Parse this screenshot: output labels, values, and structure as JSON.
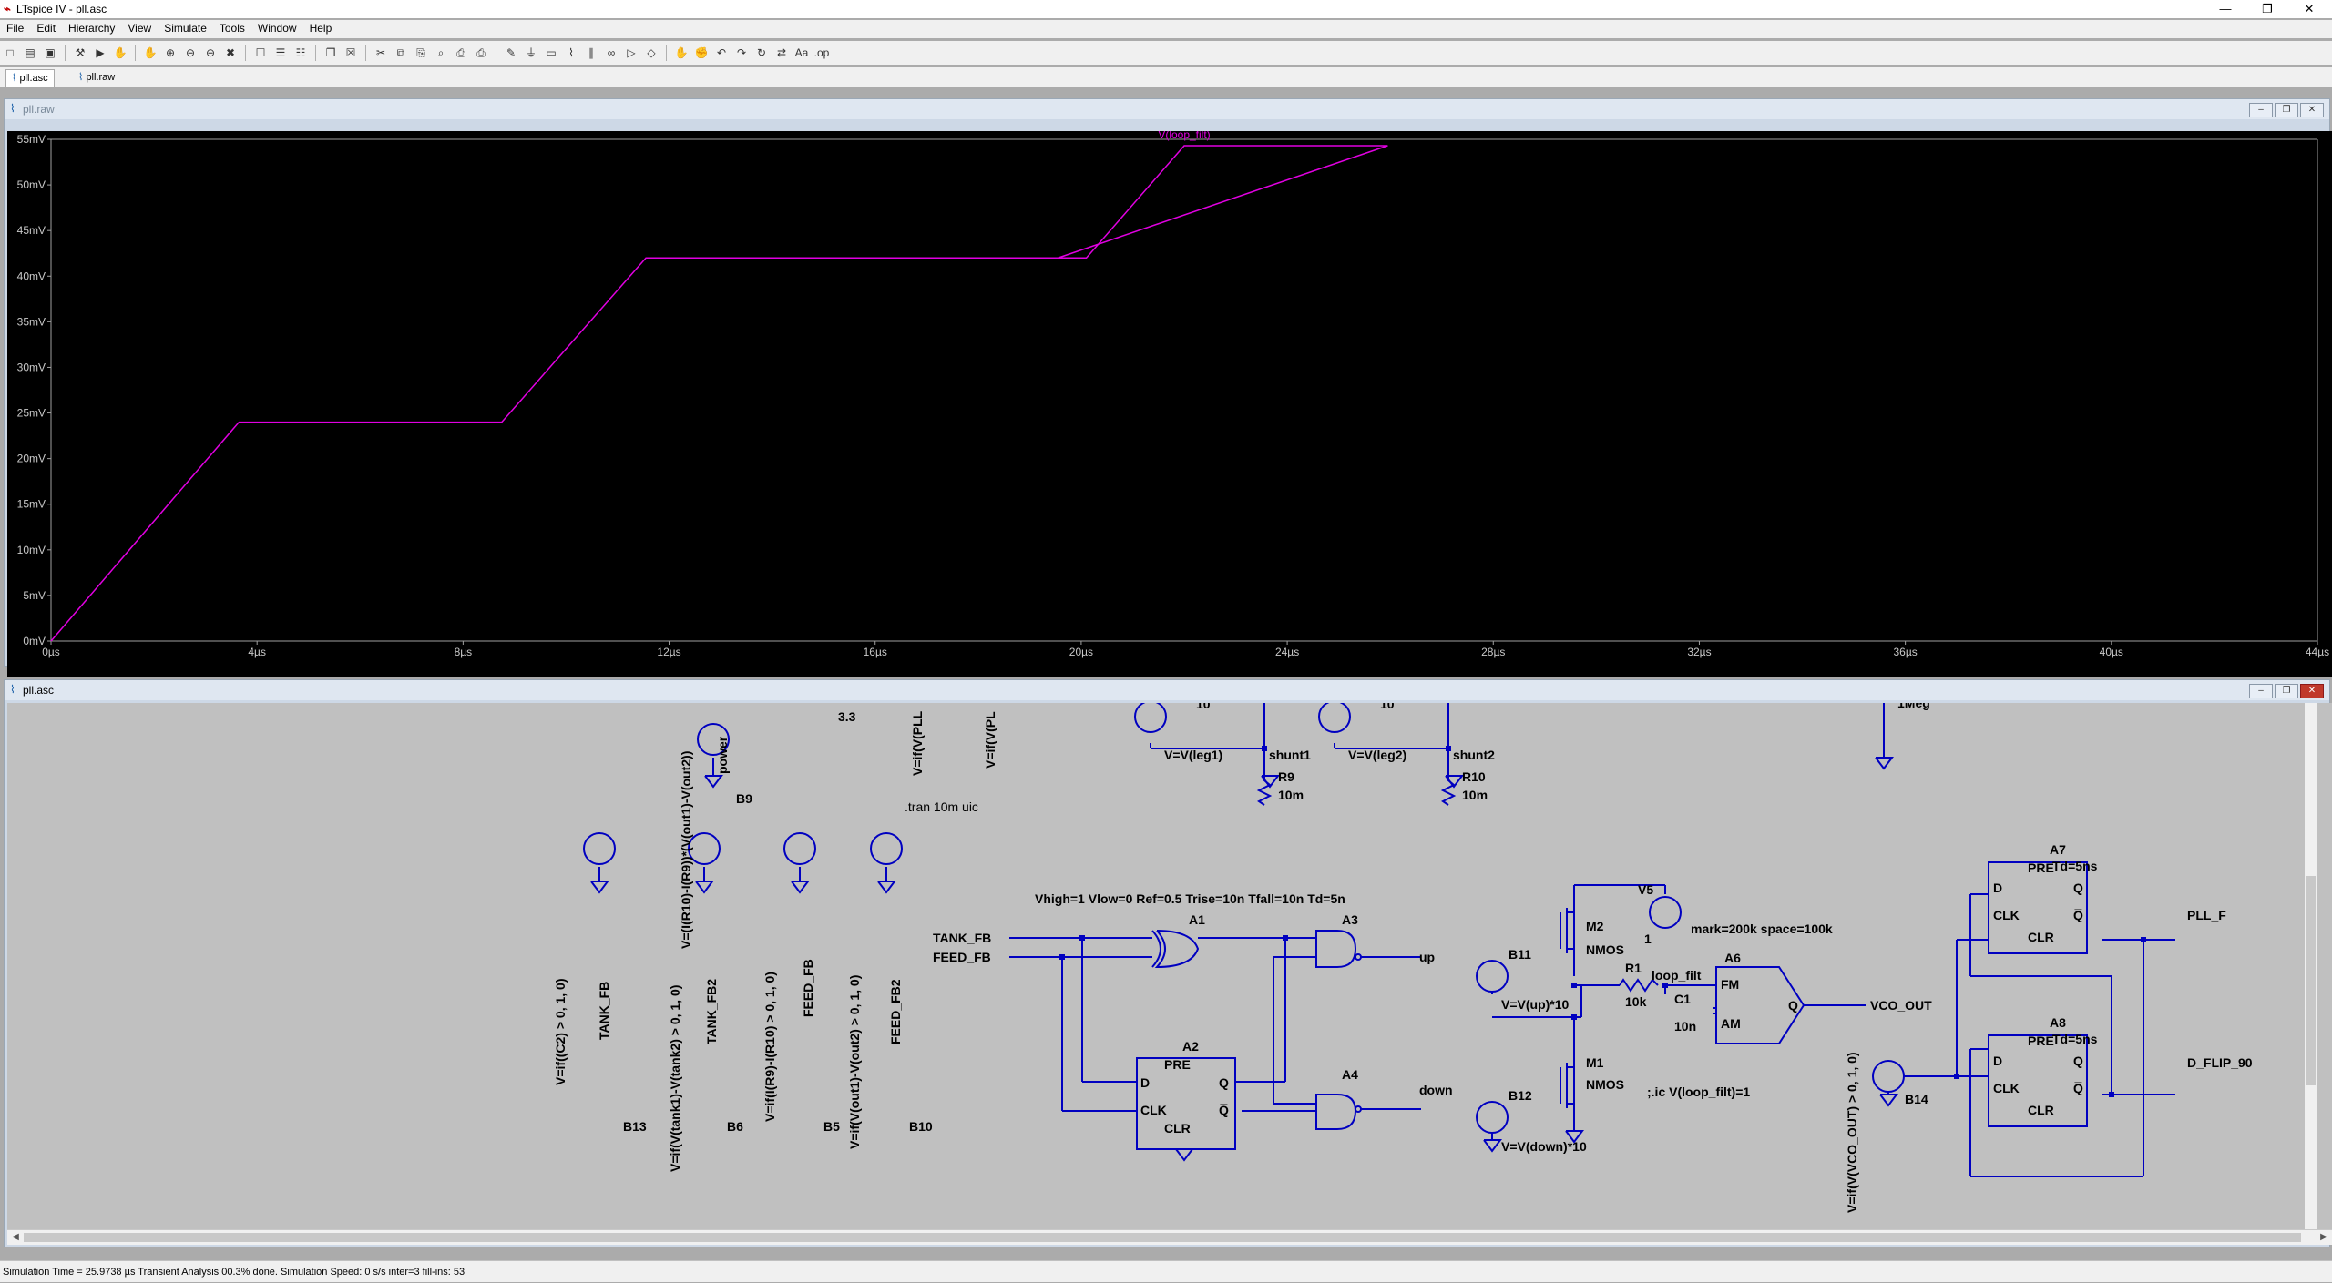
{
  "app": {
    "title": "LTspice IV - pll.asc",
    "window_controls": {
      "minimize": "—",
      "maximize": "❐",
      "close": "✕"
    }
  },
  "menu": [
    "File",
    "Edit",
    "Hierarchy",
    "View",
    "Simulate",
    "Tools",
    "Window",
    "Help"
  ],
  "toolbar": {
    "icons": [
      "new-schematic-icon",
      "open-icon",
      "save-icon",
      "control-panel-icon",
      "run-icon",
      "halt-icon",
      "pan-icon",
      "zoom-in-icon",
      "zoom-back-icon",
      "zoom-out-icon",
      "zoom-fit-icon",
      "autorange-icon",
      "tile-horizontal-icon",
      "tile-vertical-icon",
      "cascade-icon",
      "close-window-icon",
      "cut-icon",
      "copy-icon",
      "paste-icon",
      "find-icon",
      "print-icon",
      "print-preview-icon",
      "wire-icon",
      "ground-icon",
      "label-net-icon",
      "resistor-icon",
      "capacitor-icon",
      "inductor-icon",
      "diode-icon",
      "component-icon",
      "move-icon",
      "drag-icon",
      "undo-icon",
      "redo-icon",
      "rotate-icon",
      "mirror-icon",
      "text-icon",
      "spice-directive-icon"
    ],
    "glyphs": [
      "□",
      "▤",
      "▣",
      "⚒",
      "▶",
      "✋",
      "✋",
      "⊕",
      "⊖",
      "⊖",
      "✖",
      "☐",
      "☰",
      "☷",
      "❐",
      "☒",
      "✂",
      "⧉",
      "⎘",
      "⌕",
      "⎙",
      "⎙",
      "✎",
      "⏚",
      "▭",
      "⌇",
      "∥",
      "∞",
      "▷",
      "◇",
      "✋",
      "✊",
      "↶",
      "↷",
      "↻",
      "⇄",
      "Aa",
      ".op"
    ]
  },
  "tabs": [
    {
      "label": "pll.asc",
      "active": true
    },
    {
      "label": "pll.raw",
      "active": false
    }
  ],
  "waveform_window": {
    "title": "pll.raw",
    "trace_label": "V(loop_filt)",
    "trace_color": "#e100e1"
  },
  "schematic_window": {
    "title": "pll.asc"
  },
  "chart_data": {
    "type": "line",
    "title": "",
    "xlabel": "",
    "ylabel": "",
    "x_unit": "µs",
    "y_unit": "mV",
    "xlim": [
      0,
      44
    ],
    "ylim": [
      0,
      55
    ],
    "x_ticks": [
      "0µs",
      "4µs",
      "8µs",
      "12µs",
      "16µs",
      "20µs",
      "24µs",
      "28µs",
      "32µs",
      "36µs",
      "40µs",
      "44µs"
    ],
    "y_ticks": [
      "0mV",
      "5mV",
      "10mV",
      "15mV",
      "20mV",
      "25mV",
      "30mV",
      "35mV",
      "40mV",
      "45mV",
      "50mV",
      "55mV"
    ],
    "series": [
      {
        "name": "V(loop_filt)",
        "x": [
          0,
          3.65,
          8.75,
          11.55,
          19.55,
          20.1,
          22.0,
          25.95,
          19.55
        ],
        "y": [
          0,
          24.0,
          24.0,
          42.0,
          42.0,
          42.0,
          54.3,
          54.3,
          42.0
        ]
      }
    ],
    "grid": false,
    "legend": "top-center"
  },
  "schematic": {
    "labels": {
      "b13_expr": "V=if((C2) > 0, 1, 0)",
      "b6_expr": "V=if(V(tank1)-V(tank2) > 0, 1, 0)",
      "b9_expr": "V=(I(R10)-I(R9))*(V(out1)-V(out2))",
      "b5_expr": "V=if(I(R9)-I(R10) > 0, 1, 0)",
      "b10_expr": "V=if(V(out1)-V(out2) > 0, 1, 0)",
      "b14_expr": "V=if(V(VCO_OUT) > 0, 1, 0)",
      "tank_fb": "TANK_FB",
      "tank_fb2": "TANK_FB2",
      "feed_fb": "FEED_FB",
      "feed_fb2": "FEED_FB2",
      "power": "power",
      "b13": "B13",
      "b6": "B6",
      "b9": "B9",
      "b5": "B5",
      "b10": "B10",
      "b11": "B11",
      "b12": "B12",
      "b14": "B14",
      "v33": "3.3",
      "vpll1": "V=if(V(PLL",
      "vpll2": "V=if(V(PL",
      "tran": ".tran 10m uic",
      "top10a": "10",
      "top10b": "10",
      "vleg1": "V=V(leg1)",
      "vleg2": "V=V(leg2)",
      "shunt1": "shunt1",
      "shunt2": "shunt2",
      "r9": "R9",
      "r9v": "10m",
      "r10": "R10",
      "r10v": "10m",
      "onemeg": "1Meg",
      "digital_model": "Vhigh=1 Vlow=0 Ref=0.5 Trise=10n Tfall=10n Td=5n",
      "tank_fb_net": "TANK_FB",
      "feed_fb_net": "FEED_FB",
      "a1": "A1",
      "a2": "A2",
      "a3": "A3",
      "a4": "A4",
      "a6": "A6",
      "a7": "A7",
      "a8": "A8",
      "up": "up",
      "down": "down",
      "pre": "PRE",
      "d": "D",
      "clk": "CLK",
      "clr": "CLR",
      "q": "Q",
      "qbar": "Q̅",
      "m1": "M1",
      "m2": "M2",
      "nmos1": "NMOS",
      "nmos2": "NMOS",
      "v5": "V5",
      "v5val": "1",
      "fsk": "mark=200k space=100k",
      "r1": "R1",
      "r1v": "10k",
      "c1": "C1",
      "c1v": "10n",
      "loop_filt": "loop_filt",
      "fm": "FM",
      "am": "AM",
      "vco_out": "VCO_OUT",
      "b11_expr": "V=V(up)*10",
      "b12_expr": "V=V(down)*10",
      "ic": ";.ic V(loop_filt)=1",
      "td5ns_a": "Td=5ns",
      "td5ns_b": "Td=5ns",
      "pll_f": "PLL_F",
      "d_flip_90": "D_FLIP_90"
    }
  },
  "status": {
    "text": "Simulation Time = 25.9738 µs  Transient Analysis 00.3% done. Simulation Speed: 0 s/s inter=3 fill-ins: 53"
  }
}
